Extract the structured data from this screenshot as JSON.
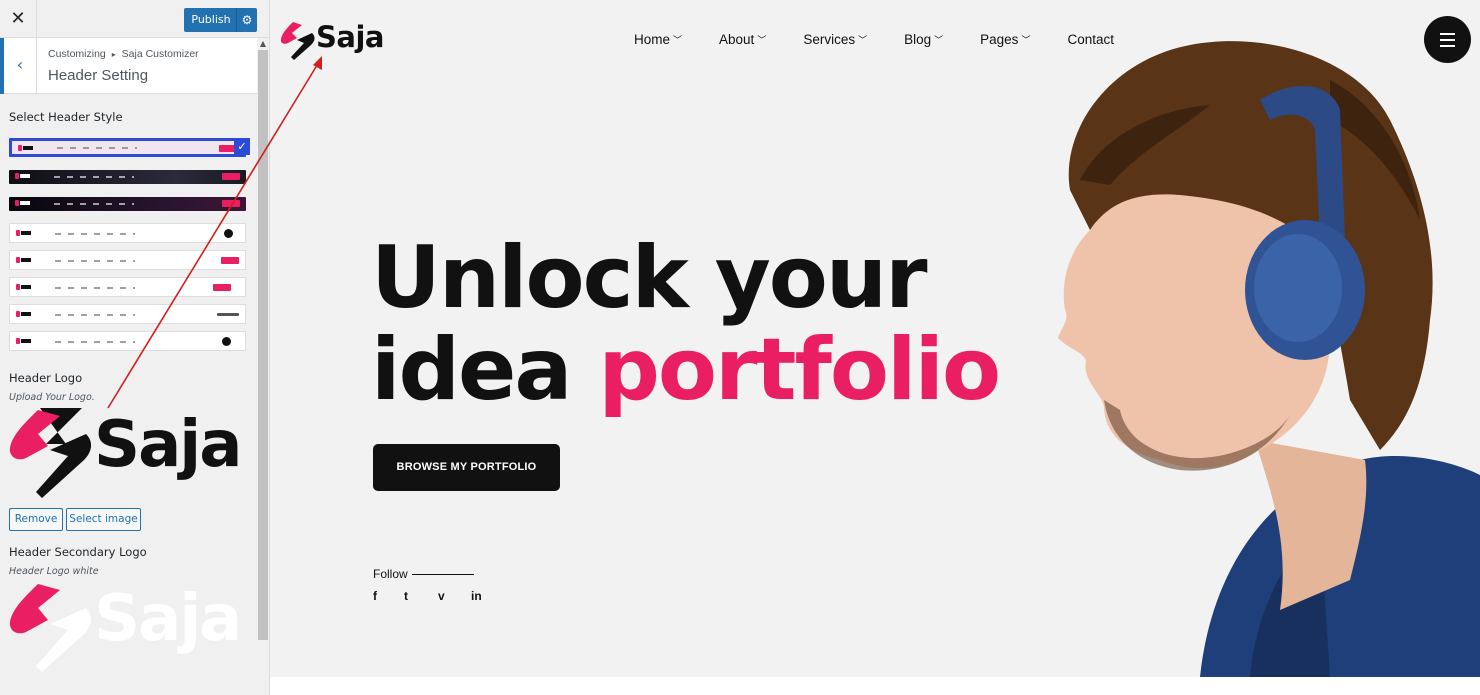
{
  "customizer": {
    "close_label": "✕",
    "publish_label": "Publish",
    "breadcrumb_root": "Customizing",
    "breadcrumb_sep": "▸",
    "breadcrumb_panel": "Saja Customizer",
    "section_title": "Header Setting",
    "header_style_label": "Select Header Style",
    "header_logo_label": "Header Logo",
    "header_logo_desc": "Upload Your Logo.",
    "remove_label": "Remove",
    "select_image_label": "Select image",
    "secondary_logo_label": "Header Secondary Logo",
    "secondary_logo_desc": "Header Logo white",
    "logo_wordmark": "Saja"
  },
  "site": {
    "logo_text": "Saja",
    "nav": [
      {
        "label": "Home"
      },
      {
        "label": "About"
      },
      {
        "label": "Services"
      },
      {
        "label": "Blog"
      },
      {
        "label": "Pages"
      },
      {
        "label": "Contact"
      }
    ],
    "hero_line1": "Unlock your",
    "hero_line2_plain": "idea ",
    "hero_line2_accent": "portfolio",
    "cta_label": "BROWSE MY PORTFOLIO",
    "follow_label": "Follow",
    "social": {
      "facebook": "f",
      "twitter": "t",
      "vimeo": "v",
      "linkedin": "in"
    }
  },
  "colors": {
    "accent": "#e91e63",
    "wp_blue": "#2271b1",
    "dark": "#111111",
    "annotation_arrow": "#d21f1f"
  },
  "icons": [
    "close-icon",
    "gear-icon",
    "back-chevron-icon",
    "check-icon",
    "chevron-down-icon",
    "hamburger-icon",
    "facebook-icon",
    "twitter-icon",
    "vimeo-icon",
    "linkedin-icon"
  ]
}
